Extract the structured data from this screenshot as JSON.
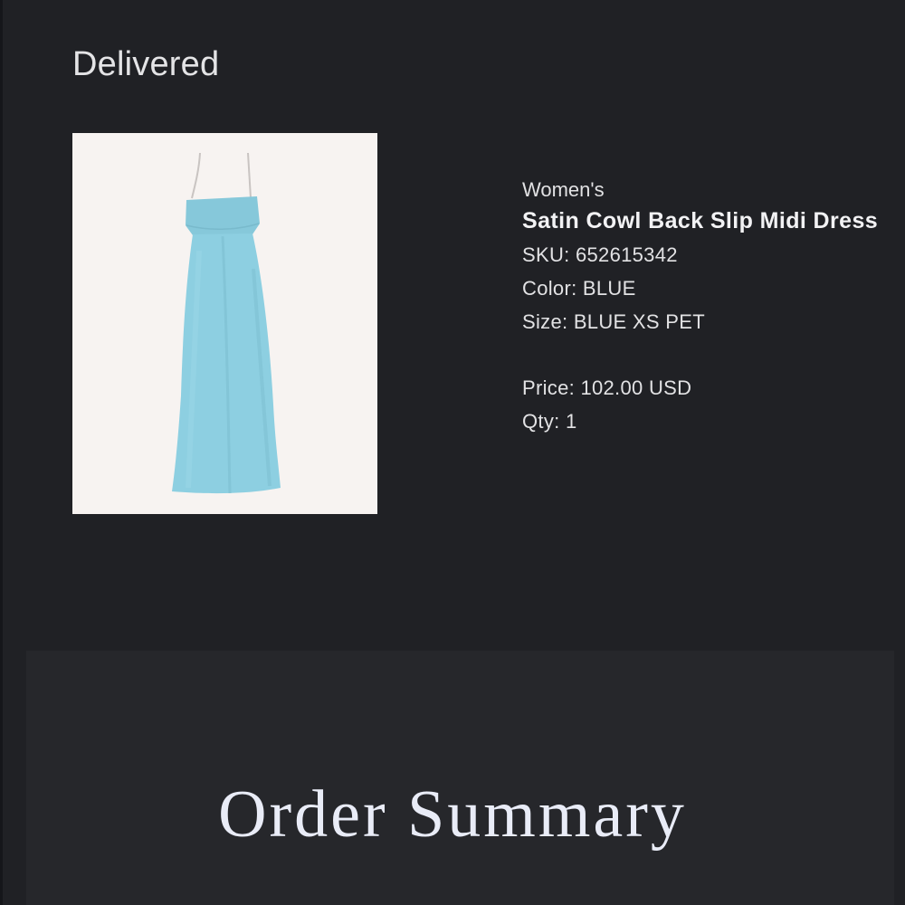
{
  "order": {
    "status": "Delivered"
  },
  "product": {
    "image_icon": "dress-image",
    "image_color": "#8ecfe0",
    "category": "Women's",
    "name": "Satin Cowl Back Slip Midi Dress",
    "sku": "SKU: 652615342",
    "color": "Color: BLUE",
    "size": "Size: BLUE XS PET",
    "price": "Price: 102.00 USD",
    "qty": "Qty: 1"
  },
  "summary": {
    "title": "Order Summary"
  }
}
